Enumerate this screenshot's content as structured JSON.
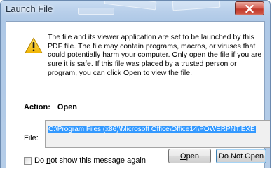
{
  "window": {
    "title": "Launch File",
    "close_glyph": "close-icon"
  },
  "dialog": {
    "message": "The file and its viewer application are set to be launched by this PDF file. The file may contain programs, macros, or viruses that could potentially harm your computer. Only open the file if you are sure it is safe. If this file was placed by a trusted person or program, you can click Open to view the file.",
    "warning_icon": "warning-icon",
    "action_label": "Action:",
    "action_value": "Open",
    "file_label": "File:",
    "file_path": "C:\\Program Files (x86)\\Microsoft Office\\Office14\\POWERPNT.EXE",
    "checkbox": {
      "pre": "Do ",
      "underlined": "n",
      "post": "ot show this message again",
      "checked": false
    },
    "buttons": {
      "open_underlined": "O",
      "open_rest": "pen",
      "do_not_open": "Do Not Open"
    }
  },
  "colors": {
    "title_bar": "#b8cfea",
    "close_button": "#c9463a",
    "selection": "#3399ff",
    "default_button_border": "#3c7fb1"
  }
}
